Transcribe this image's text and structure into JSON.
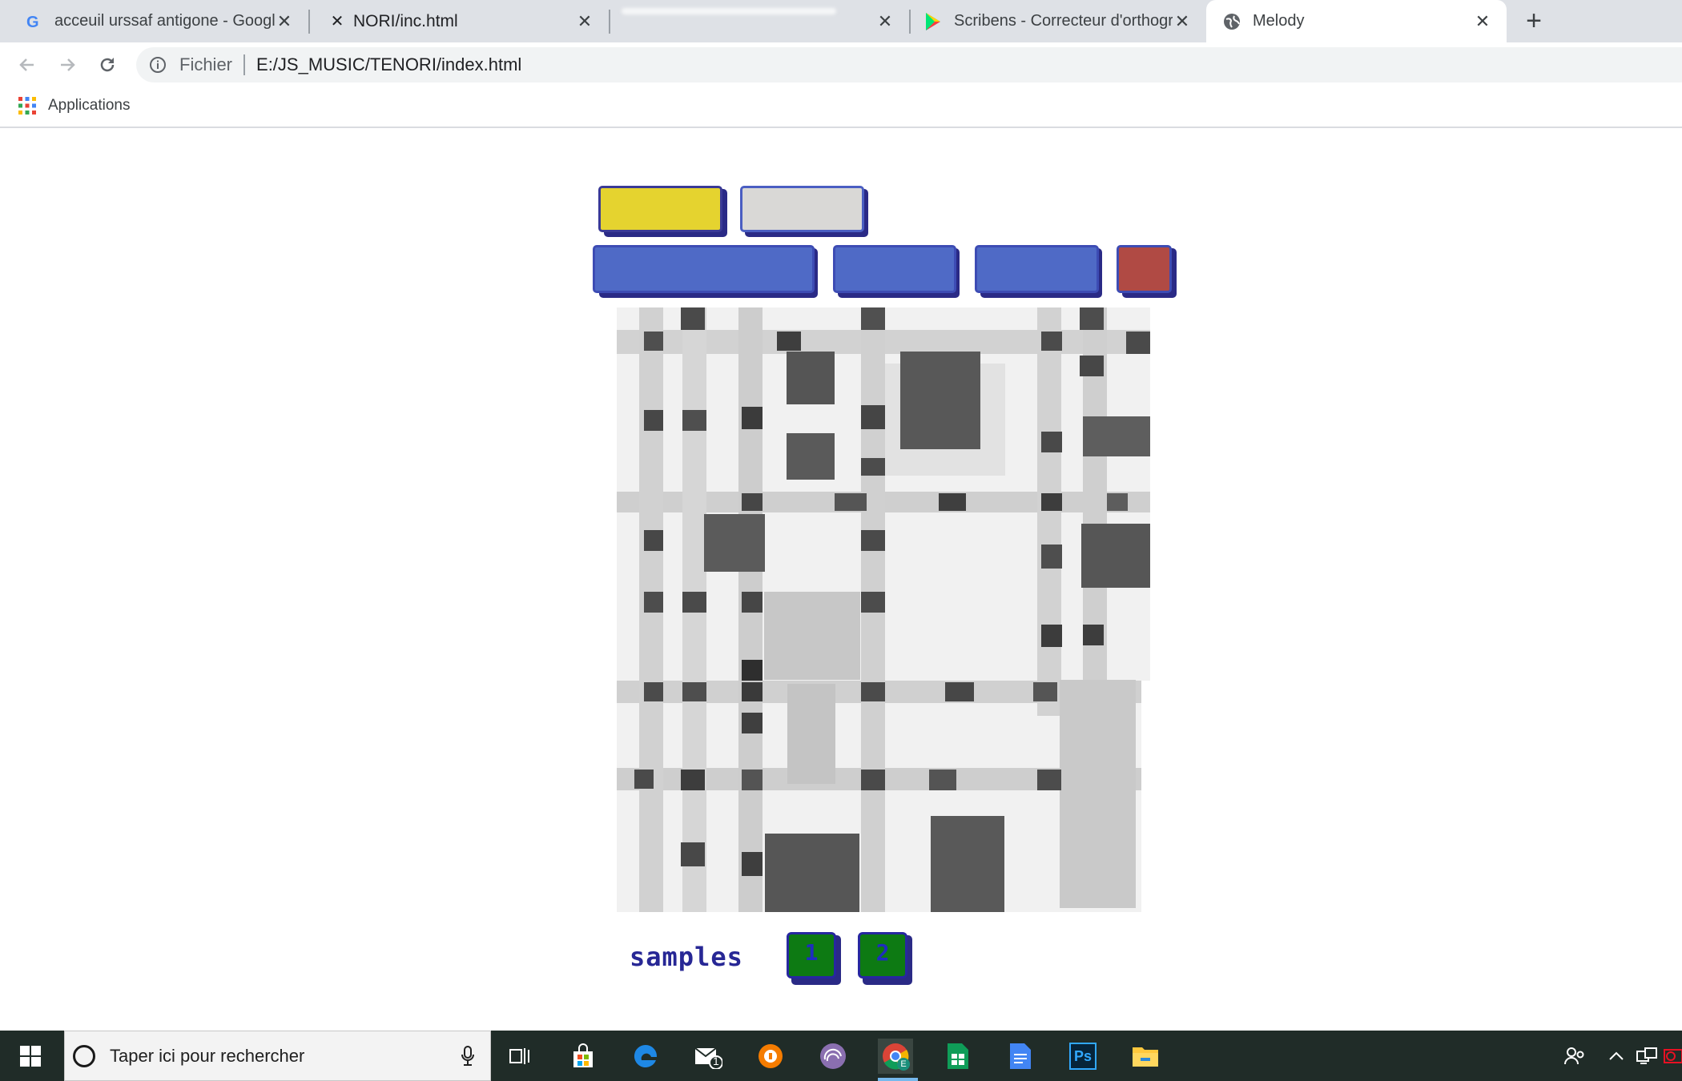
{
  "browser": {
    "tabs": [
      {
        "title": "acceuil urssaf antigone - Google",
        "favicon": "google-icon"
      },
      {
        "title": "NORI/inc.html",
        "favicon": "close-mark-icon"
      },
      {
        "title": "",
        "favicon": ""
      },
      {
        "title": "Scribens - Correcteur d'orthograp",
        "favicon": "play-store-icon"
      },
      {
        "title": "Melody",
        "favicon": "globe-icon",
        "active": true
      }
    ],
    "new_tab_label": "+",
    "close_glyph": "✕",
    "address": {
      "scheme": "Fichier",
      "url": "E:/JS_MUSIC/TENORI/index.html"
    },
    "bookmarks": {
      "apps_label": "Applications"
    }
  },
  "page": {
    "top_buttons_row1": [
      {
        "name": "yellow-button",
        "color": "#e5d32f"
      },
      {
        "name": "grey-button",
        "color": "#d9d8d6"
      }
    ],
    "top_buttons_row2": [
      {
        "name": "blue-button-wide",
        "color": "#4f6ac6"
      },
      {
        "name": "blue-button-2",
        "color": "#4f6ac6"
      },
      {
        "name": "blue-button-3",
        "color": "#4f6ac6"
      },
      {
        "name": "red-button",
        "color": "#b04a44"
      }
    ],
    "samples": {
      "label": "samples",
      "buttons": [
        "1",
        "2"
      ]
    }
  },
  "taskbar": {
    "search_placeholder": "Taper ici pour rechercher",
    "mail_badge": "1",
    "chrome_badge": "E",
    "photoshop_label": "Ps"
  }
}
